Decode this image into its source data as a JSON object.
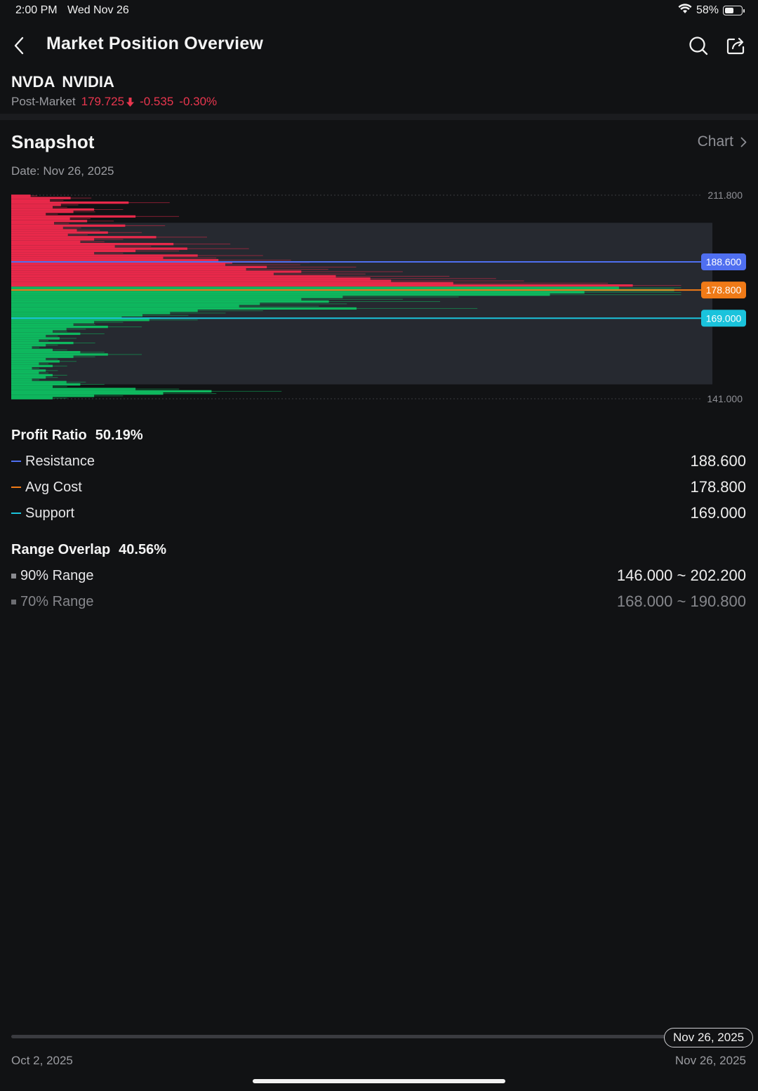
{
  "status_bar": {
    "time": "2:00 PM",
    "date": "Wed Nov 26",
    "battery": "58%",
    "battery_level": 0.58
  },
  "header": {
    "title": "Market Position Overview"
  },
  "stock": {
    "symbol": "NVDA",
    "name": "NVIDIA",
    "session": "Post-Market",
    "price": "179.725",
    "change": "-0.535",
    "change_pct": "-0.30%",
    "down_color": "#e8364e"
  },
  "snapshot": {
    "title": "Snapshot",
    "chart_link": "Chart",
    "date_text": "Date: Nov 26, 2025"
  },
  "chart_data": {
    "type": "bar",
    "orientation": "horizontal",
    "ylim": [
      141.0,
      211.8
    ],
    "y_tick_labels": [
      "211.800",
      "141.000"
    ],
    "profit_color": "#e8294a",
    "loss_color": "#0fb85e",
    "range_band": {
      "low": 146.0,
      "high": 202.2
    },
    "markers": [
      {
        "label": "188.600",
        "value": 188.6,
        "color": "#4f6ff0"
      },
      {
        "label": "178.800",
        "value": 178.8,
        "color": "#f07a17"
      },
      {
        "label": "169.000",
        "value": 169.0,
        "color": "#1ac3dc"
      }
    ],
    "split_price": 179.7,
    "distribution": [
      [
        211.6,
        0.028
      ],
      [
        210.8,
        0.086
      ],
      [
        210.0,
        0.056
      ],
      [
        209.2,
        0.17
      ],
      [
        208.4,
        0.072
      ],
      [
        207.6,
        0.06
      ],
      [
        206.8,
        0.12
      ],
      [
        206.0,
        0.09
      ],
      [
        205.2,
        0.05
      ],
      [
        204.4,
        0.18
      ],
      [
        203.6,
        0.085
      ],
      [
        202.8,
        0.11
      ],
      [
        202.0,
        0.062
      ],
      [
        201.2,
        0.165
      ],
      [
        200.4,
        0.075
      ],
      [
        199.6,
        0.095
      ],
      [
        198.8,
        0.14
      ],
      [
        198.0,
        0.082
      ],
      [
        197.2,
        0.21
      ],
      [
        196.4,
        0.12
      ],
      [
        195.6,
        0.1
      ],
      [
        194.8,
        0.235
      ],
      [
        194.0,
        0.15
      ],
      [
        193.2,
        0.255
      ],
      [
        192.4,
        0.18
      ],
      [
        191.6,
        0.12
      ],
      [
        190.8,
        0.27
      ],
      [
        190.0,
        0.22
      ],
      [
        189.2,
        0.3
      ],
      [
        188.4,
        0.32
      ],
      [
        187.6,
        0.31
      ],
      [
        186.8,
        0.37
      ],
      [
        186.0,
        0.34
      ],
      [
        185.2,
        0.42
      ],
      [
        184.4,
        0.38
      ],
      [
        183.6,
        0.47
      ],
      [
        182.8,
        0.52
      ],
      [
        182.0,
        0.55
      ],
      [
        181.2,
        0.64
      ],
      [
        180.4,
        0.9
      ],
      [
        179.6,
        0.88
      ],
      [
        178.8,
        0.96
      ],
      [
        178.0,
        0.83
      ],
      [
        177.2,
        0.78
      ],
      [
        176.4,
        0.48
      ],
      [
        175.6,
        0.42
      ],
      [
        174.8,
        0.46
      ],
      [
        174.0,
        0.36
      ],
      [
        173.2,
        0.33
      ],
      [
        172.4,
        0.5
      ],
      [
        171.6,
        0.27
      ],
      [
        170.8,
        0.23
      ],
      [
        170.0,
        0.19
      ],
      [
        169.2,
        0.16
      ],
      [
        168.4,
        0.2
      ],
      [
        167.6,
        0.12
      ],
      [
        166.8,
        0.09
      ],
      [
        166.0,
        0.14
      ],
      [
        165.2,
        0.08
      ],
      [
        164.4,
        0.06
      ],
      [
        163.6,
        0.1
      ],
      [
        162.8,
        0.05
      ],
      [
        162.0,
        0.07
      ],
      [
        161.2,
        0.04
      ],
      [
        160.4,
        0.09
      ],
      [
        159.6,
        0.05
      ],
      [
        158.8,
        0.03
      ],
      [
        158.0,
        0.06
      ],
      [
        157.2,
        0.1
      ],
      [
        156.4,
        0.14
      ],
      [
        155.6,
        0.09
      ],
      [
        154.8,
        0.05
      ],
      [
        154.0,
        0.07
      ],
      [
        153.2,
        0.04
      ],
      [
        152.4,
        0.06
      ],
      [
        151.6,
        0.03
      ],
      [
        150.8,
        0.05
      ],
      [
        150.0,
        0.04
      ],
      [
        149.2,
        0.06
      ],
      [
        148.4,
        0.05
      ],
      [
        147.6,
        0.03
      ],
      [
        146.8,
        0.08
      ],
      [
        146.0,
        0.1
      ],
      [
        145.2,
        0.06
      ],
      [
        144.4,
        0.18
      ],
      [
        143.6,
        0.29
      ],
      [
        142.8,
        0.22
      ],
      [
        142.0,
        0.12
      ],
      [
        141.2,
        0.06
      ]
    ]
  },
  "profit": {
    "label": "Profit Ratio",
    "value": "50.19%",
    "rows": [
      {
        "label": "Resistance",
        "value": "188.600",
        "color": "#4f6ff0"
      },
      {
        "label": "Avg Cost",
        "value": "178.800",
        "color": "#f07a17"
      },
      {
        "label": "Support",
        "value": "169.000",
        "color": "#1ac3dc"
      }
    ]
  },
  "overlap": {
    "label": "Range Overlap",
    "value": "40.56%",
    "rows": [
      {
        "label": "90% Range",
        "value": "146.000 ~ 202.200"
      },
      {
        "label": "70% Range",
        "value": "168.000 ~ 190.800"
      }
    ]
  },
  "timeline": {
    "start": "Oct 2, 2025",
    "end": "Nov 26, 2025",
    "selected": "Nov 26, 2025",
    "position": 1.0
  }
}
